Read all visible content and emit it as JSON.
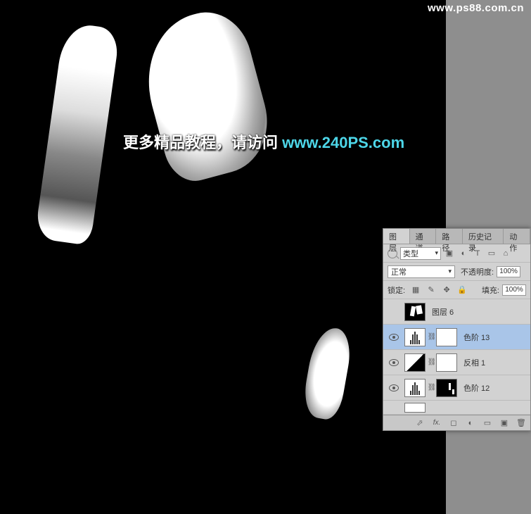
{
  "watermark_top": "www.ps88.com.cn",
  "center_text": {
    "part1": "更多精品教程，请访问 ",
    "part2": "www.240PS.com"
  },
  "panel": {
    "tabs": [
      "图层",
      "通道",
      "路径",
      "历史记录",
      "动作"
    ],
    "active_tab": 0,
    "filter": {
      "kind_label": "类型",
      "icons": [
        "image-icon",
        "adjust-icon",
        "text-icon",
        "shape-icon",
        "smart-icon"
      ]
    },
    "blend": {
      "mode": "正常",
      "opacity_label": "不透明度:",
      "opacity_value": "100%"
    },
    "lock": {
      "label": "锁定:",
      "fill_label": "填充:",
      "fill_value": "100%"
    },
    "layers": [
      {
        "visible": false,
        "type": "pixel",
        "name": "图层 6",
        "selected": false
      },
      {
        "visible": true,
        "type": "levels",
        "mask": "white",
        "name": "色阶 13",
        "selected": true
      },
      {
        "visible": true,
        "type": "invert",
        "mask": "white",
        "name": "反相 1",
        "selected": false
      },
      {
        "visible": true,
        "type": "levels",
        "mask": "shapes",
        "name": "色阶 12",
        "selected": false
      }
    ],
    "footer_icons": [
      "link-icon",
      "fx-icon",
      "mask-icon",
      "adjustment-icon",
      "group-icon",
      "new-icon",
      "trash-icon"
    ]
  }
}
